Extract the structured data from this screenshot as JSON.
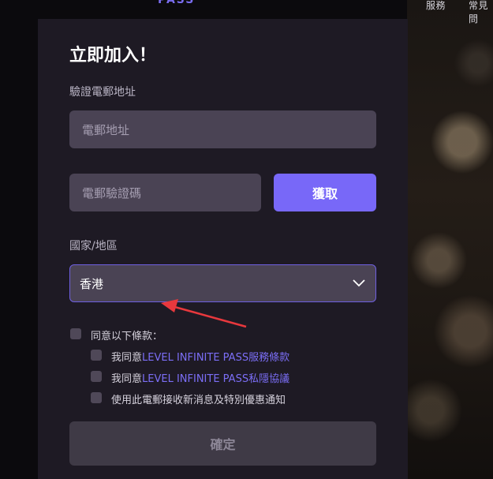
{
  "header": {
    "logo_text": "PASS",
    "nav": [
      "服務",
      "常見問"
    ]
  },
  "form": {
    "title": "立即加入！",
    "email_label": "驗證電郵地址",
    "email_placeholder": "電郵地址",
    "code_placeholder": "電郵驗證碼",
    "get_code_button": "獲取",
    "region_label": "國家/地區",
    "region_value": "香港",
    "agree_all": "同意以下條款：",
    "terms_prefix": "我同意",
    "terms_link": "LEVEL INFINITE PASS服務條款",
    "privacy_prefix": "我同意",
    "privacy_link": "LEVEL INFINITE PASS私隱協議",
    "newsletter": "使用此電郵接收新消息及特別優惠通知",
    "confirm_button": "確定"
  },
  "colors": {
    "accent": "#7868f8",
    "link": "#7b6ef6",
    "annotation_arrow": "#e8383d"
  }
}
